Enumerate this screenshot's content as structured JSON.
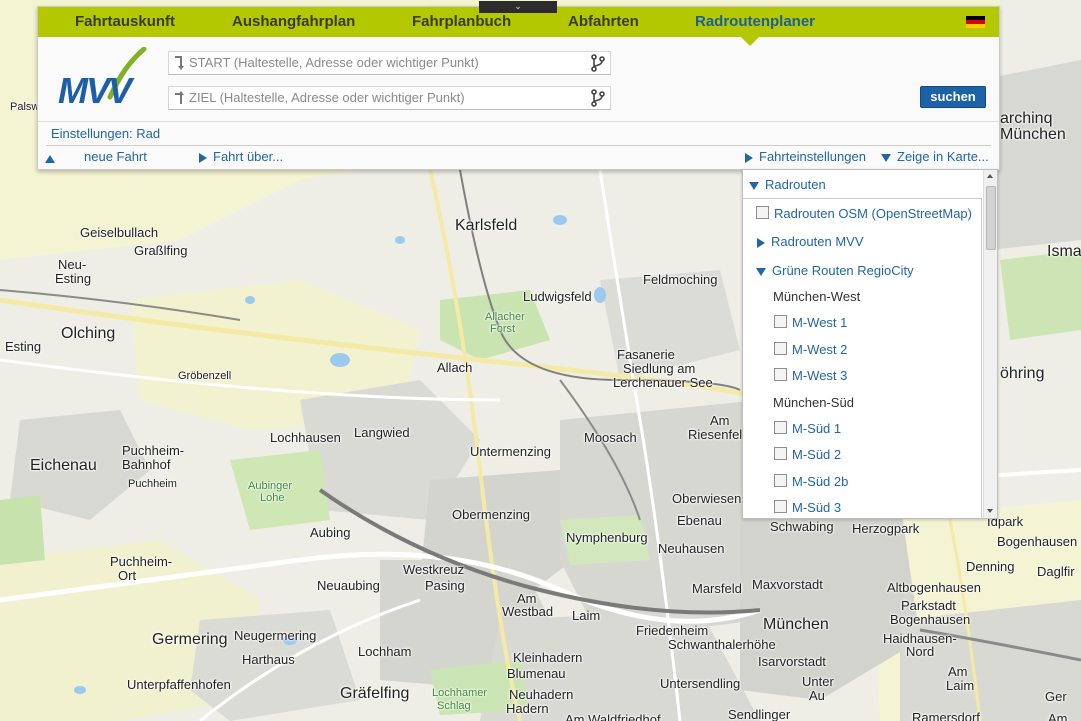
{
  "nav": {
    "collapse_glyph": "⌄",
    "tabs": [
      "Fahrtauskunft",
      "Aushangfahrplan",
      "Fahrplanbuch",
      "Abfahrten",
      "Radroutenplaner"
    ],
    "active_tab": "Radroutenplaner",
    "language_icon": "german-flag-icon"
  },
  "logo": {
    "text": "MVV"
  },
  "form": {
    "start_placeholder": "START (Haltestelle, Adresse oder wichtiger Punkt)",
    "ziel_placeholder": "ZIEL (Haltestelle, Adresse oder wichtiger Punkt)",
    "start_value": "",
    "ziel_value": "",
    "search_label": "suchen",
    "settings_label": "Einstellungen: Rad"
  },
  "actions": {
    "new_trip": "neue Fahrt",
    "via": "Fahrt über...",
    "trip_settings": "Fahrteinstellungen",
    "show_in_map": "Zeige in Karte..."
  },
  "layers": {
    "header": "Radrouten",
    "osm": "Radrouten OSM (OpenStreetMap)",
    "mvv": "Radrouten MVV",
    "regio": "Grüne Routen RegioCity",
    "group_west": "München-West",
    "west": [
      "M-West 1",
      "M-West 2",
      "M-West 3"
    ],
    "group_sued": "München-Süd",
    "sued": [
      "M-Süd 1",
      "M-Süd 2",
      "M-Süd 2b",
      "M-Süd 3"
    ]
  },
  "map": {
    "places": [
      "Palsw",
      "Geiselbullach",
      "Graßlfing",
      "Neu-",
      "Esting",
      "Olching",
      "Esting",
      "Karlsfeld",
      "Ludwigsfeld",
      "Feldmoching",
      "Allacher",
      "Forst",
      "Fasanerie",
      "Siedlung am",
      "Lerchenauer See",
      "Allach",
      "Gröbenzell",
      "Lochhausen",
      "Langwied",
      "Moosach",
      "Am",
      "Riesenfeld",
      "Untermenzing",
      "Eichenau",
      "Puchheim-",
      "Bahnhof",
      "Puchheim",
      "Aubinger",
      "Lohe",
      "Obermenzing",
      "Oberwiesen",
      "Ebenau",
      "Aubing",
      "Nymphenburg",
      "Neuhausen",
      "Schwabing",
      "Herzogpark",
      "Puchheim-",
      "Ort",
      "Westkreuz",
      "Pasing",
      "Neuaubing",
      "Marsfeld",
      "Maxvorstadt",
      "Am",
      "Westbad",
      "Laim",
      "Friedenheim",
      "München",
      "Germering",
      "Neugermering",
      "Harthaus",
      "Lochham",
      "Kleinhadern",
      "Blumenau",
      "Schwanthalerhöhe",
      "Isarvorstadt",
      "Unterpfaffenhofen",
      "Gräfelfing",
      "Lochhamer",
      "Schlag",
      "Neuhadern",
      "Hadern",
      "Untersendling",
      "Am Waldfriedhof",
      "Sendlinger",
      "Unter",
      "Au",
      "archinq",
      "München",
      "Isma",
      "öhring",
      "Idpark",
      "Bogenhausen",
      "Denning",
      "Daglfir",
      "Altbogenhausen",
      "Parkstadt",
      "Bogenhausen",
      "Haidhausen-",
      "Nord",
      "Am",
      "Laim",
      "Ramersdorf",
      "Ger",
      "Am"
    ]
  }
}
